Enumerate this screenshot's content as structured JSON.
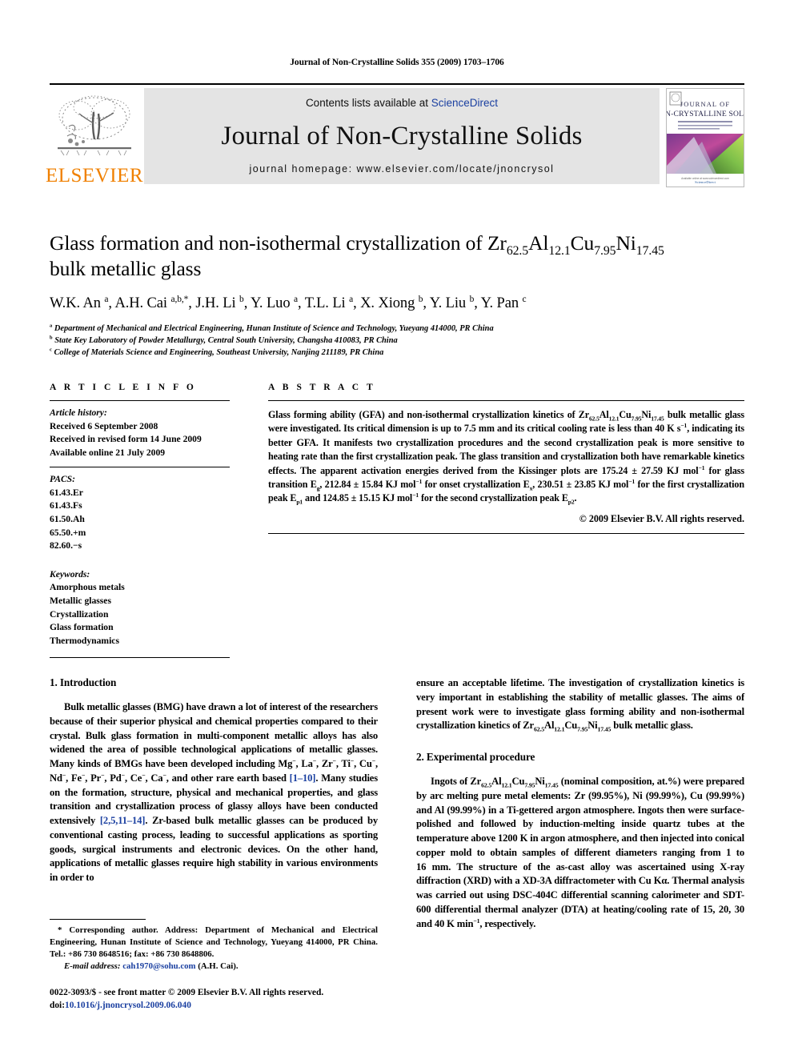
{
  "running_head": "Journal of Non-Crystalline Solids 355 (2009) 1703–1706",
  "masthead": {
    "publisher_name": "ELSEVIER",
    "contents_prefix": "Contents lists available at ",
    "contents_link": "ScienceDirect",
    "journal_title": "Journal of Non-Crystalline Solids",
    "homepage": "journal homepage: www.elsevier.com/locate/jnoncrysol",
    "cover": {
      "line1": "JOURNAL OF",
      "line2": "NON-CRYSTALLINE SOLIDS",
      "footer": "ScienceDirect"
    }
  },
  "article": {
    "title_line1": "Glass formation and non-isothermal crystallization of Zr",
    "title_sub1": "62.5",
    "title_mid1": "Al",
    "title_sub2": "12.1",
    "title_mid2": "Cu",
    "title_sub3": "7.95",
    "title_mid3": "Ni",
    "title_sub4": "17.45",
    "title_line2": "bulk metallic glass",
    "authors": "W.K. An a, A.H. Cai a,b,*, J.H. Li b, Y. Luo a, T.L. Li a, X. Xiong b, Y. Liu b, Y. Pan c",
    "affiliations": [
      {
        "marker": "a",
        "text": "Department of Mechanical and Electrical Engineering, Hunan Institute of Science and Technology, Yueyang 414000, PR China"
      },
      {
        "marker": "b",
        "text": "State Key Laboratory of Powder Metallurgy, Central South University, Changsha 410083, PR China"
      },
      {
        "marker": "c",
        "text": "College of Materials Science and Engineering, Southeast University, Nanjing 211189, PR China"
      }
    ]
  },
  "article_info": {
    "heading": "A R T I C L E  I N F O",
    "history_label": "Article history:",
    "history": [
      "Received 6 September 2008",
      "Received in revised form 14 June 2009",
      "Available online 21 July 2009"
    ],
    "pacs_label": "PACS:",
    "pacs": [
      "61.43.Er",
      "61.43.Fs",
      "61.50.Ah",
      "65.50.+m",
      "82.60.−s"
    ],
    "keywords_label": "Keywords:",
    "keywords": [
      "Amorphous metals",
      "Metallic glasses",
      "Crystallization",
      "Glass formation",
      "Thermodynamics"
    ]
  },
  "abstract": {
    "heading": "A B S T R A C T",
    "copyright": "© 2009 Elsevier B.V. All rights reserved."
  },
  "sections": {
    "intro_heading": "1. Introduction",
    "experimental_heading": "2. Experimental procedure"
  },
  "footnote": {
    "corresponding": "* Corresponding author. Address: Department of Mechanical and Electrical Engineering, Hunan Institute of Science and Technology, Yueyang 414000, PR China. Tel.: +86 730 8648516; fax: +86 730 8648806.",
    "email_label": "E-mail address:",
    "email": "cah1970@sohu.com",
    "email_suffix": "(A.H. Cai)."
  },
  "bottom": {
    "issn_line": "0022-3093/$ - see front matter © 2009 Elsevier B.V. All rights reserved.",
    "doi_prefix": "doi:",
    "doi": "10.1016/j.jnoncrysol.2009.06.040"
  },
  "colors": {
    "link_blue": "#1a3fa0",
    "elsevier_orange": "#F08000",
    "band_gray": "#e4e4e4"
  }
}
